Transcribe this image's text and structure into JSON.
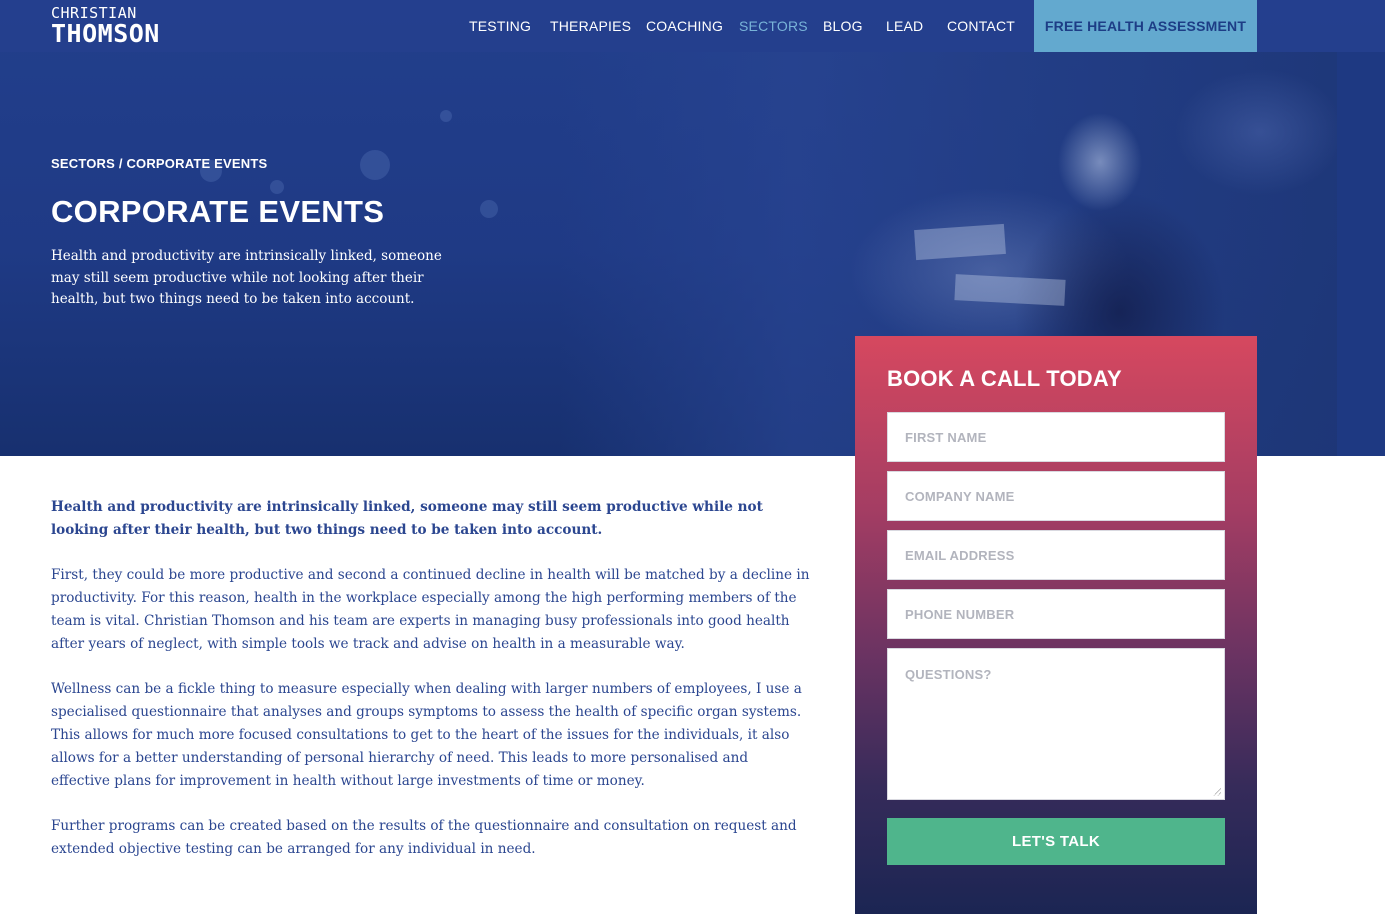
{
  "header": {
    "logo": {
      "line1": "CHRISTIAN",
      "line2": "THOMSON"
    },
    "nav": [
      {
        "label": "TESTING",
        "active": false
      },
      {
        "label": "THERAPIES",
        "active": false
      },
      {
        "label": "COACHING",
        "active": false
      },
      {
        "label": "SECTORS",
        "active": true
      },
      {
        "label": "BLOG",
        "active": false
      },
      {
        "label": "LEAD",
        "active": false
      },
      {
        "label": "CONTACT",
        "active": false
      }
    ],
    "cta": "FREE HEALTH ASSESSMENT"
  },
  "hero": {
    "breadcrumb": "SECTORS / CORPORATE EVENTS",
    "title": "CORPORATE EVENTS",
    "intro": "Health and productivity are intrinsically linked, someone may still seem productive while not looking after their health, but two things need to be taken into account."
  },
  "content": {
    "paragraphs": [
      "Health and productivity are intrinsically linked, someone may still seem productive while not looking after their health, but two things need to be taken into account.",
      "First, they could be more productive and second a continued decline in health will be matched by a decline in productivity. For this reason, health in the workplace especially among the high performing members of the team is vital. Christian Thomson and his team are experts in managing busy professionals into good health after years of neglect, with simple tools we track and advise on health in a measurable way.",
      "Wellness can be a fickle thing to measure especially when dealing with larger numbers of employees, I use a specialised questionnaire that analyses and groups symptoms to assess the health of specific organ systems. This allows for much more focused consultations to get to the heart of the issues for the individuals, it also allows for a better understanding of personal hierarchy of need. This leads to more personalised and effective plans for improvement in health without large investments of time or money.",
      "Further programs can be created based on the results of the questionnaire and consultation on request and extended objective testing can be arranged for any individual in need."
    ]
  },
  "form": {
    "title": "BOOK A CALL TODAY",
    "fields": {
      "first_name": {
        "placeholder": "FIRST NAME",
        "value": ""
      },
      "company_name": {
        "placeholder": "COMPANY NAME",
        "value": ""
      },
      "email": {
        "placeholder": "EMAIL ADDRESS",
        "value": ""
      },
      "phone": {
        "placeholder": "PHONE NUMBER",
        "value": ""
      },
      "questions": {
        "placeholder": "QUESTIONS?",
        "value": ""
      }
    },
    "submit": "LET'S TALK"
  },
  "colors": {
    "brand_blue": "#223f8c",
    "nav_active": "#78b3d8",
    "cta_bg": "#63a9cf",
    "body_text": "#2b4690",
    "form_top": "#d6485f",
    "form_bottom": "#1b2553",
    "submit_bg": "#4fb58c"
  }
}
